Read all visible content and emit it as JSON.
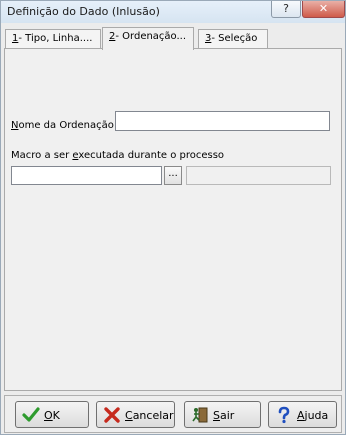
{
  "window": {
    "title": "Definição do Dado (Inlusão)",
    "help_label": "?",
    "close_label": "✕"
  },
  "tabs": [
    {
      "key": "1",
      "label": "- Tipo, Linha...."
    },
    {
      "key": "2",
      "label": "- Ordenação..."
    },
    {
      "key": "3",
      "label": "- Seleção"
    }
  ],
  "form": {
    "ordenacao_label_key": "N",
    "ordenacao_label_rest": "ome da Ordenação",
    "ordenacao_value": "",
    "macro_label_pre": "Macro a ser ",
    "macro_label_key": "e",
    "macro_label_post": "xecutada durante o processo",
    "macro_value": "",
    "ellipsis_label": "...",
    "macro_display": ""
  },
  "buttons": {
    "ok_key": "O",
    "ok_rest": "K",
    "cancel_key": "C",
    "cancel_rest": "ancelar",
    "exit_key": "S",
    "exit_rest": "air",
    "help_key": "A",
    "help_rest": "juda"
  },
  "colors": {
    "ok_icon": "#2e9b2e",
    "cancel_icon": "#c62a1e",
    "help_icon": "#1f4fbf"
  }
}
